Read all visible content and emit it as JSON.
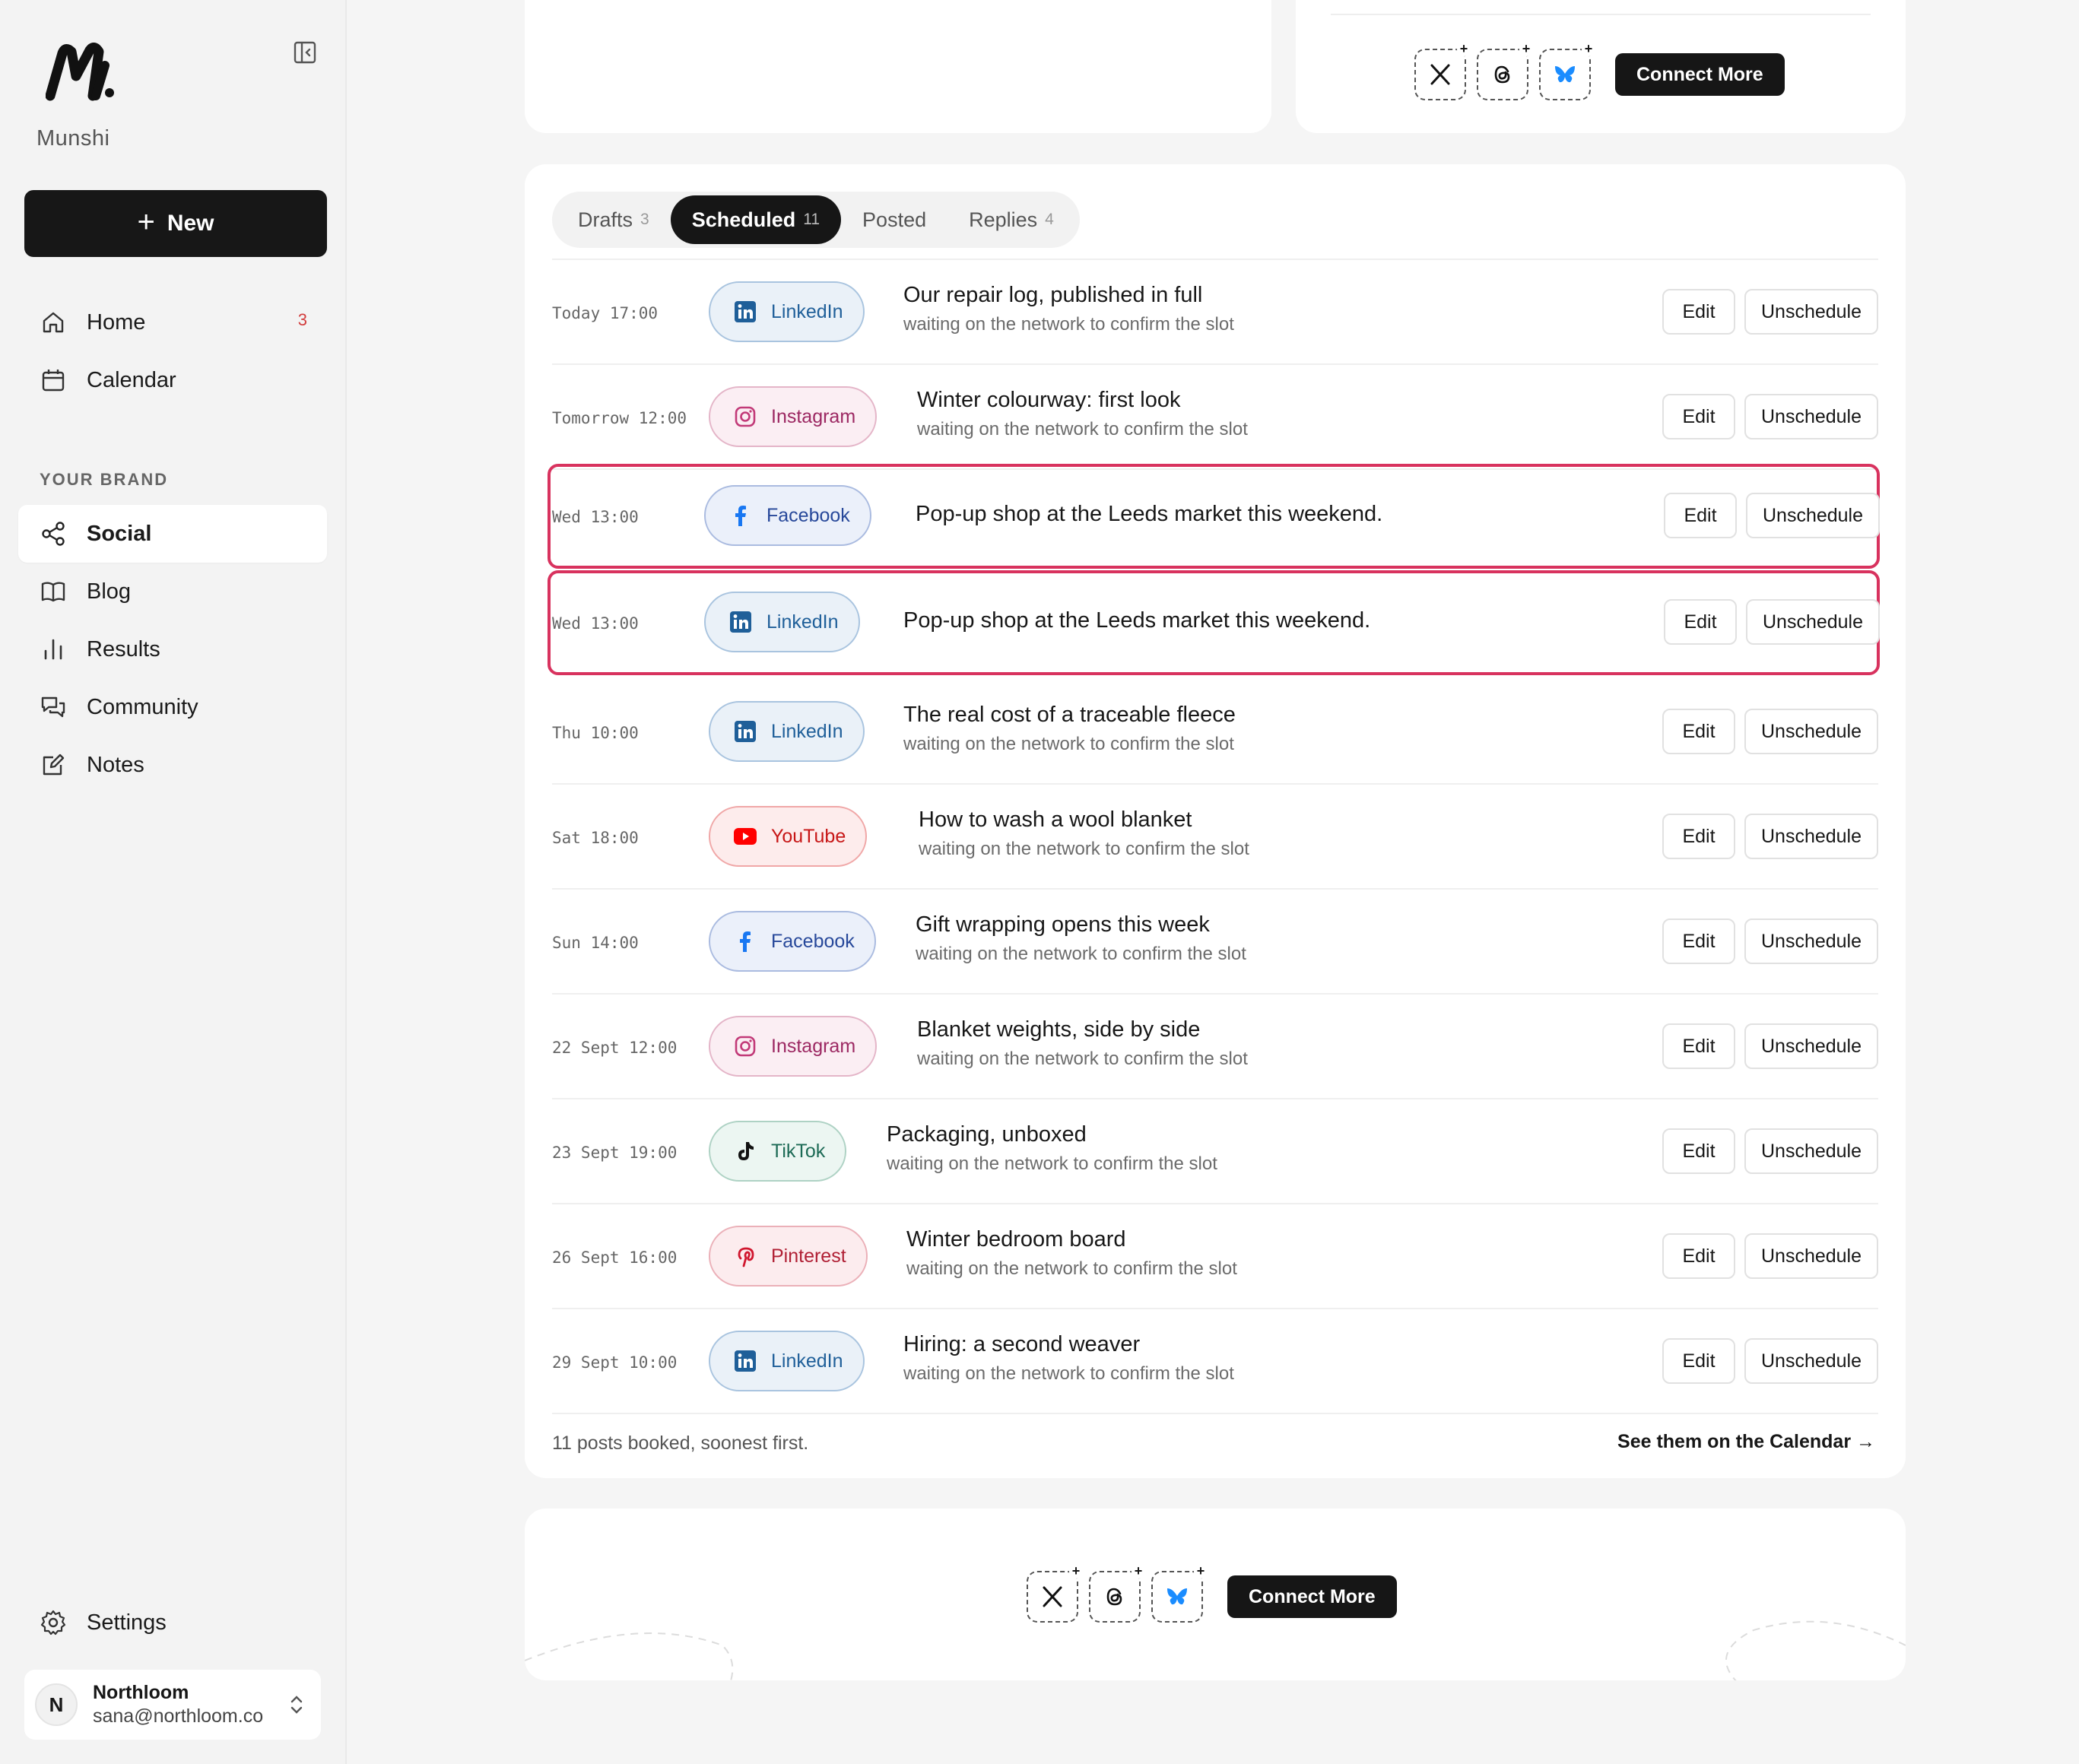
{
  "sidebar": {
    "brand": "Munshi",
    "new_label": "New",
    "nav": [
      {
        "label": "Home",
        "badge": "3"
      },
      {
        "label": "Calendar"
      }
    ],
    "section_label": "YOUR BRAND",
    "brand_nav": [
      {
        "label": "Social"
      },
      {
        "label": "Blog"
      },
      {
        "label": "Results"
      },
      {
        "label": "Community"
      },
      {
        "label": "Notes"
      }
    ],
    "settings_label": "Settings",
    "account": {
      "initial": "N",
      "name": "Northloom",
      "email": "sana@northloom.co"
    }
  },
  "connect": {
    "button": "Connect More",
    "icons": [
      "x-icon",
      "threads-icon",
      "bluesky-icon"
    ]
  },
  "tabs": [
    {
      "label": "Drafts",
      "count": "3"
    },
    {
      "label": "Scheduled",
      "count": "11"
    },
    {
      "label": "Posted",
      "count": ""
    },
    {
      "label": "Replies",
      "count": "4"
    }
  ],
  "actions": {
    "edit": "Edit",
    "unschedule": "Unschedule"
  },
  "posts": [
    {
      "time": "Today 17:00",
      "network": "LinkedIn",
      "title": "Our repair log, published in full",
      "sub": "waiting on the network to confirm the slot"
    },
    {
      "time": "Tomorrow 12:00",
      "network": "Instagram",
      "title": "Winter colourway: first look",
      "sub": "waiting on the network to confirm the slot"
    },
    {
      "time": "Wed 13:00",
      "network": "Facebook",
      "title": "Pop-up shop at the Leeds market this weekend.",
      "sub": ""
    },
    {
      "time": "Wed 13:00",
      "network": "LinkedIn",
      "title": "Pop-up shop at the Leeds market this weekend.",
      "sub": ""
    },
    {
      "time": "Thu 10:00",
      "network": "LinkedIn",
      "title": "The real cost of a traceable fleece",
      "sub": "waiting on the network to confirm the slot"
    },
    {
      "time": "Sat 18:00",
      "network": "YouTube",
      "title": "How to wash a wool blanket",
      "sub": "waiting on the network to confirm the slot"
    },
    {
      "time": "Sun 14:00",
      "network": "Facebook",
      "title": "Gift wrapping opens this week",
      "sub": "waiting on the network to confirm the slot"
    },
    {
      "time": "22 Sept 12:00",
      "network": "Instagram",
      "title": "Blanket weights, side by side",
      "sub": "waiting on the network to confirm the slot"
    },
    {
      "time": "23 Sept 19:00",
      "network": "TikTok",
      "title": "Packaging, unboxed",
      "sub": "waiting on the network to confirm the slot"
    },
    {
      "time": "26 Sept 16:00",
      "network": "Pinterest",
      "title": "Winter bedroom board",
      "sub": "waiting on the network to confirm the slot"
    },
    {
      "time": "29 Sept 10:00",
      "network": "LinkedIn",
      "title": "Hiring: a second weaver",
      "sub": "waiting on the network to confirm the slot"
    }
  ],
  "footer": {
    "summary": "11 posts booked, soonest first.",
    "link": "See them on the Calendar →"
  },
  "colors": {
    "highlight": "#d8325e",
    "primary": "#161616"
  }
}
